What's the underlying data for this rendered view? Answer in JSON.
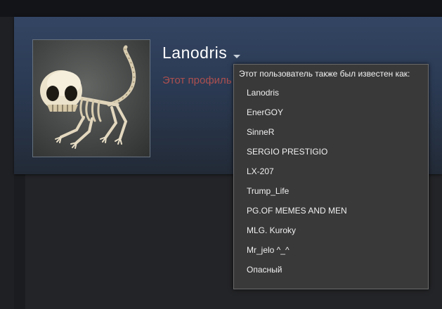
{
  "profile": {
    "persona_name": "Lanodris",
    "private_info_partial": "Этот профиль"
  },
  "alias_popup": {
    "title": "Этот пользователь также был известен как:",
    "aliases": [
      "Lanodris",
      "EnerGOY",
      "SinneR",
      "SERGIO PRESTIGIO",
      "LX-207",
      "Trump_Life",
      "PG.OF MEMES AND MEN",
      "MLG. Kuroky",
      "Mr_jelo ^_^",
      "Опасный"
    ]
  },
  "icons": {
    "name_dropdown": "caret-down-icon",
    "avatar": "skeleton-creature-avatar"
  }
}
